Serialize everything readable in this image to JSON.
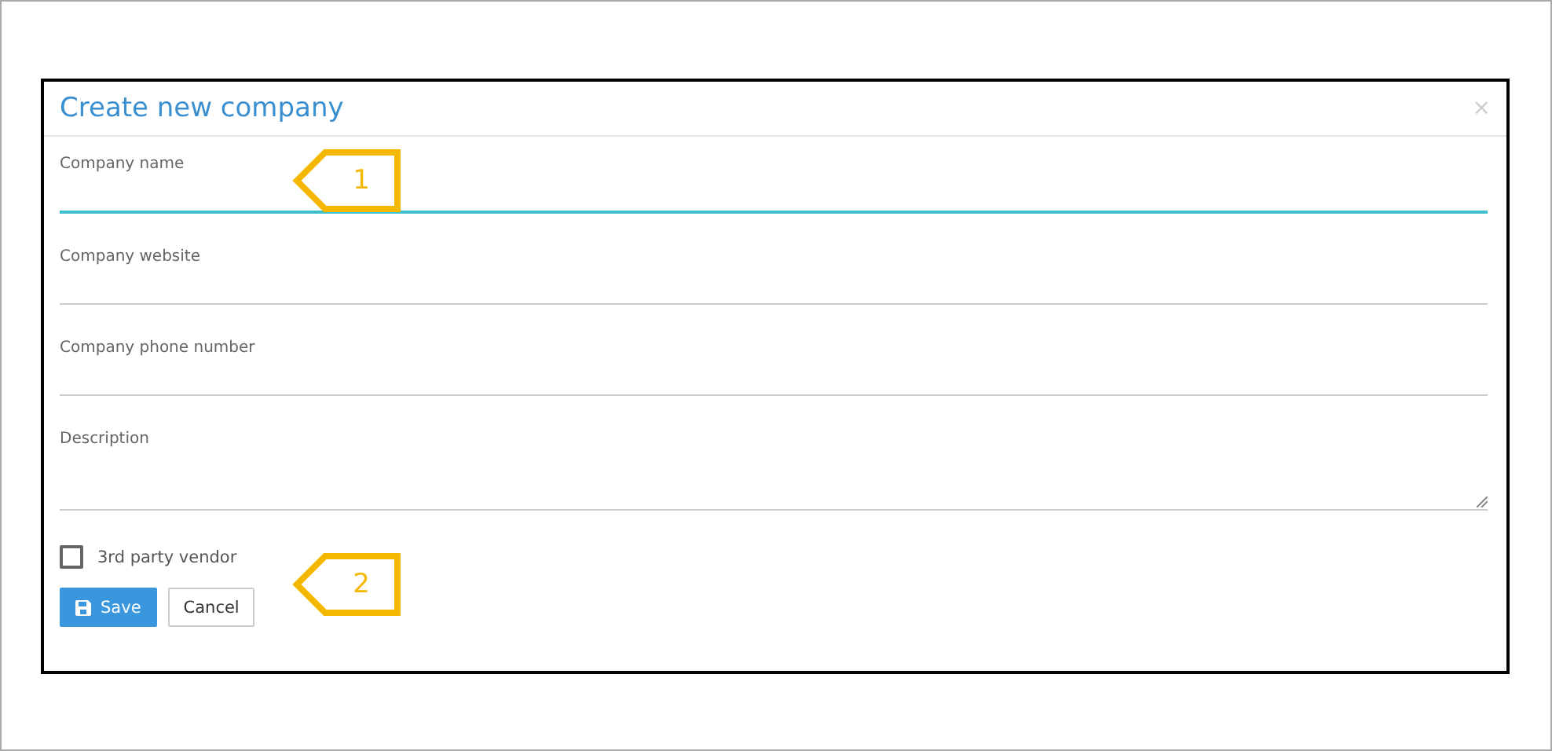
{
  "dialog": {
    "title": "Create new company",
    "close": "×"
  },
  "fields": [
    {
      "label": "Company name",
      "kind": "input",
      "focused": true
    },
    {
      "label": "Company website",
      "kind": "input",
      "focused": false
    },
    {
      "label": "Company phone number",
      "kind": "input",
      "focused": false
    },
    {
      "label": "Description",
      "kind": "textarea",
      "focused": false
    }
  ],
  "checkbox": {
    "label": "3rd party vendor",
    "checked": false
  },
  "buttons": [
    {
      "label": "Save",
      "kind": "primary"
    },
    {
      "label": "Cancel",
      "kind": "default"
    }
  ],
  "callouts": [
    {
      "number": "1"
    },
    {
      "number": "2"
    }
  ]
}
